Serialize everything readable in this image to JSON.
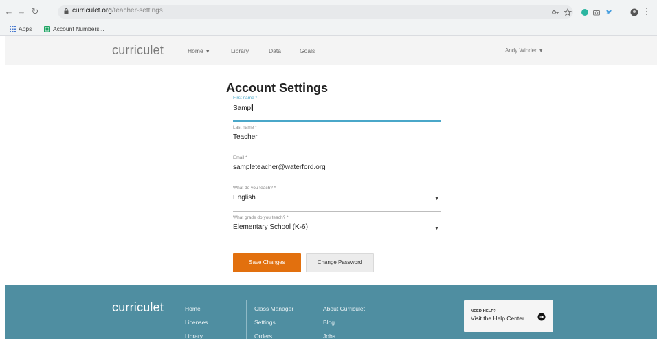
{
  "browser": {
    "url_host": "curriculet.org",
    "url_path": "/teacher-settings",
    "bookmarks": [
      {
        "label": "Apps"
      },
      {
        "label": "Account Numbers..."
      }
    ]
  },
  "header": {
    "logo": "curriculet",
    "nav": [
      {
        "label": "Home",
        "has_caret": true
      },
      {
        "label": "Library"
      },
      {
        "label": "Data"
      },
      {
        "label": "Goals"
      }
    ],
    "user": "Andy Winder"
  },
  "form": {
    "title": "Account Settings",
    "fields": [
      {
        "label": "First name *",
        "value": "Sampl",
        "active": true
      },
      {
        "label": "Last name *",
        "value": "Teacher"
      },
      {
        "label": "Email *",
        "value": "sampleteacher@waterford.org"
      },
      {
        "label": "What do you teach? *",
        "value": "English",
        "dropdown": true
      },
      {
        "label": "What grade do you teach? *",
        "value": "Elementary School (K-6)",
        "dropdown": true
      }
    ],
    "save_label": "Save Changes",
    "change_password_label": "Change Password"
  },
  "footer": {
    "logo": "curriculet",
    "col1": [
      "Home",
      "Licenses",
      "Library"
    ],
    "col2": [
      "Class Manager",
      "Settings",
      "Orders"
    ],
    "col3": [
      "About Curriculet",
      "Blog",
      "Jobs"
    ],
    "help_small": "NEED HELP?",
    "help_text": "Visit the Help Center"
  },
  "colors": {
    "accent_orange": "#e2700e",
    "footer_teal": "#4f8ea1",
    "focus_blue": "#4aa7c9"
  }
}
